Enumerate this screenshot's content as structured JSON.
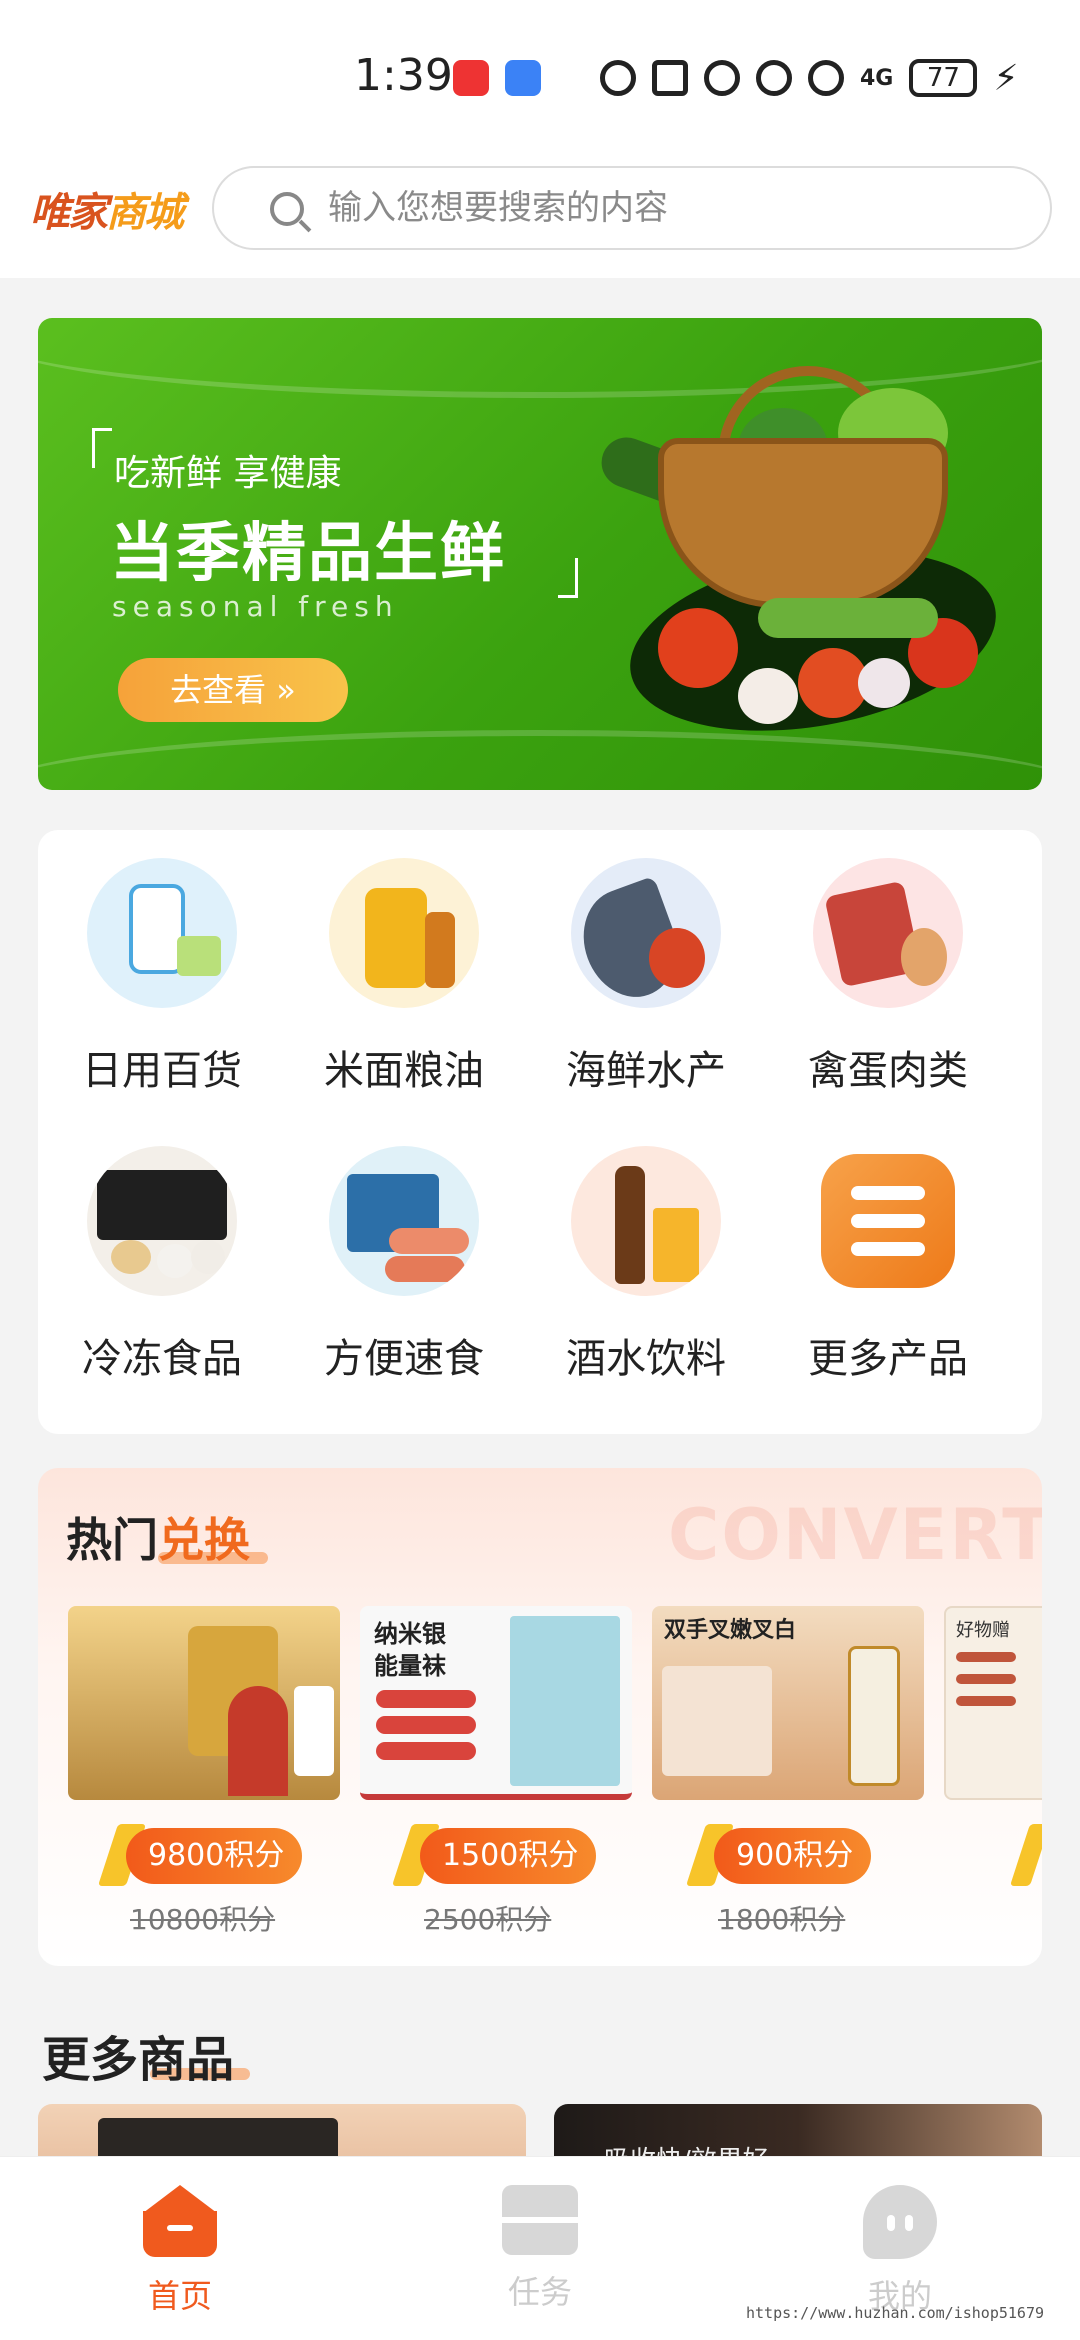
{
  "status_bar": {
    "time": "1:39",
    "network": "4G",
    "battery": "77"
  },
  "header": {
    "logo_part1": "唯家",
    "logo_part2": "商城",
    "search_placeholder": "输入您想要搜索的内容"
  },
  "banner": {
    "subtitle": "吃新鲜 享健康",
    "title": "当季精品生鲜",
    "english": "seasonal fresh",
    "button": "去查看 »"
  },
  "categories": [
    {
      "label": "日用百货",
      "icon": "detergent-icon",
      "bg": "#dff1fb"
    },
    {
      "label": "米面粮油",
      "icon": "oil-icon",
      "bg": "#fdf2d6"
    },
    {
      "label": "海鲜水产",
      "icon": "fish-icon",
      "bg": "#e4ecf8"
    },
    {
      "label": "禽蛋肉类",
      "icon": "meat-icon",
      "bg": "#fde4e4"
    },
    {
      "label": "冷冻食品",
      "icon": "frozen-food-icon",
      "bg": "#f3efe9"
    },
    {
      "label": "方便速食",
      "icon": "instant-food-icon",
      "bg": "#e0f1f8"
    },
    {
      "label": "酒水饮料",
      "icon": "beer-icon",
      "bg": "#fde8de"
    },
    {
      "label": "更多产品",
      "icon": "more-list-icon",
      "bg": "#ffffff"
    }
  ],
  "hot": {
    "title_part1": "热门",
    "title_part2": "兑换",
    "bg_word": "CONVERT",
    "products": [
      {
        "points": "9800积分",
        "old_points": "10800积分",
        "img_text": "",
        "color1": "#e9c27a",
        "color2": "#7a5b2a"
      },
      {
        "points": "1500积分",
        "old_points": "2500积分",
        "img_text": "纳米银\n能量袜",
        "color1": "#f5f5f5",
        "color2": "#c53a3a"
      },
      {
        "points": "900积分",
        "old_points": "1800积分",
        "img_text": "双手叉嫩叉白",
        "color1": "#f2d7b8",
        "color2": "#d9a06b"
      },
      {
        "points": "",
        "old_points": "",
        "img_text": "好物赠",
        "color1": "#f7efe4",
        "color2": "#b84b2f"
      }
    ]
  },
  "more": {
    "title": "更多商品",
    "card2_text": "吸收快/效果好"
  },
  "tabs": [
    {
      "label": "首页",
      "active": true,
      "color": "#f05a1e"
    },
    {
      "label": "任务",
      "active": false,
      "color": "#cccccc"
    },
    {
      "label": "我的",
      "active": false,
      "color": "#cccccc"
    }
  ],
  "watermark": "https://www.huzhan.com/ishop51679"
}
